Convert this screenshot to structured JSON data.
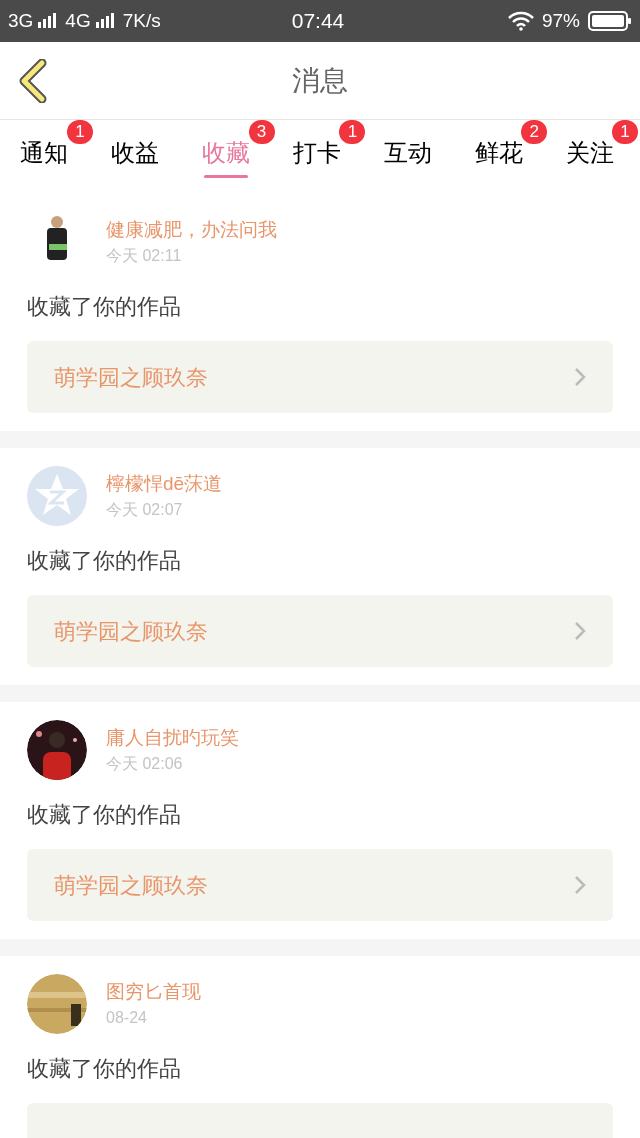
{
  "status_bar": {
    "network_1": "3G",
    "network_2": "4G",
    "speed": "7K/s",
    "time": "07:44",
    "battery": "97%"
  },
  "header": {
    "title": "消息"
  },
  "tabs": [
    {
      "label": "通知",
      "selected": false,
      "badge": "1"
    },
    {
      "label": "收益",
      "selected": false
    },
    {
      "label": "收藏",
      "selected": true,
      "badge": "3"
    },
    {
      "label": "打卡",
      "selected": false,
      "badge": "1"
    },
    {
      "label": "互动",
      "selected": false
    },
    {
      "label": "鲜花",
      "selected": false,
      "badge": "2"
    },
    {
      "label": "关注",
      "selected": false,
      "badge": "1"
    }
  ],
  "messages": [
    {
      "name": "健康减肥，办法问我",
      "time": "今天 02:11",
      "text": "收藏了你的作品",
      "work": "萌学园之顾玖奈"
    },
    {
      "avatar": {
        "kind": "default"
      },
      "name": "檸檬悍dē莯道",
      "time": "今天 02:07",
      "text": "收藏了你的作品",
      "work": "萌学园之顾玖奈"
    },
    {
      "name": "庸人自扰旳玩笑",
      "time": "今天 02:06",
      "text": "收藏了你的作品",
      "work": "萌学园之顾玖奈"
    },
    {
      "name": "图穷匕首现",
      "time": "08-24",
      "text": "收藏了你的作品"
    }
  ]
}
